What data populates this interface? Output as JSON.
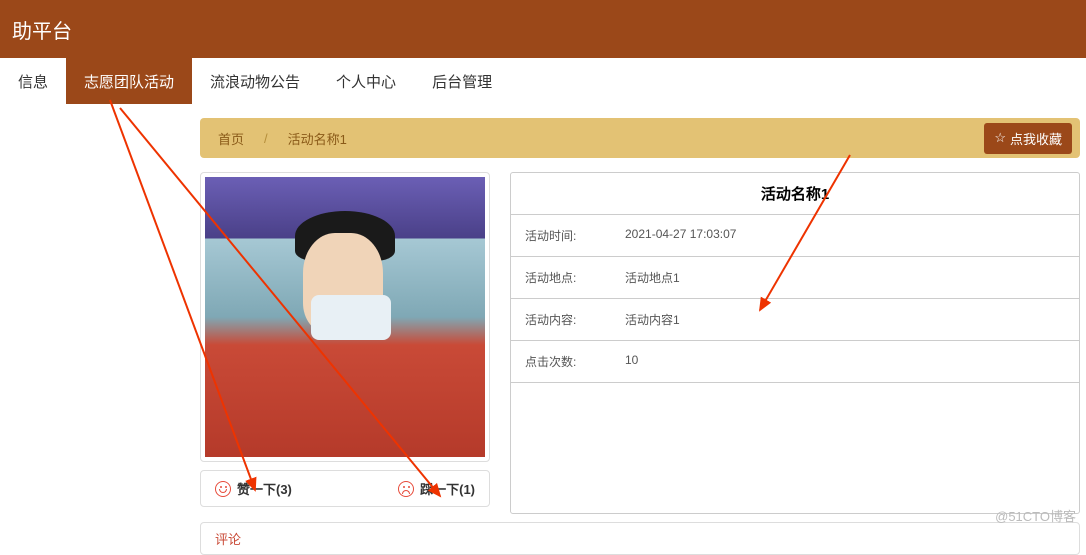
{
  "header": {
    "title": "助平台"
  },
  "nav": {
    "items": [
      {
        "label": "信息"
      },
      {
        "label": "志愿团队活动"
      },
      {
        "label": "流浪动物公告"
      },
      {
        "label": "个人中心"
      },
      {
        "label": "后台管理"
      }
    ],
    "active_index": 1
  },
  "breadcrumb": {
    "home": "首页",
    "sep": "/",
    "current": "活动名称1",
    "fav_label": "点我收藏"
  },
  "detail": {
    "title": "活动名称1",
    "rows": [
      {
        "label": "活动时间:",
        "value": "2021-04-27 17:03:07"
      },
      {
        "label": "活动地点:",
        "value": "活动地点1"
      },
      {
        "label": "活动内容:",
        "value": "活动内容1"
      },
      {
        "label": "点击次数:",
        "value": "10"
      }
    ]
  },
  "vote": {
    "like_label": "赞一下(3)",
    "dislike_label": "踩一下(1)"
  },
  "comment": {
    "label": "评论"
  },
  "watermark": "@51CTO博客"
}
